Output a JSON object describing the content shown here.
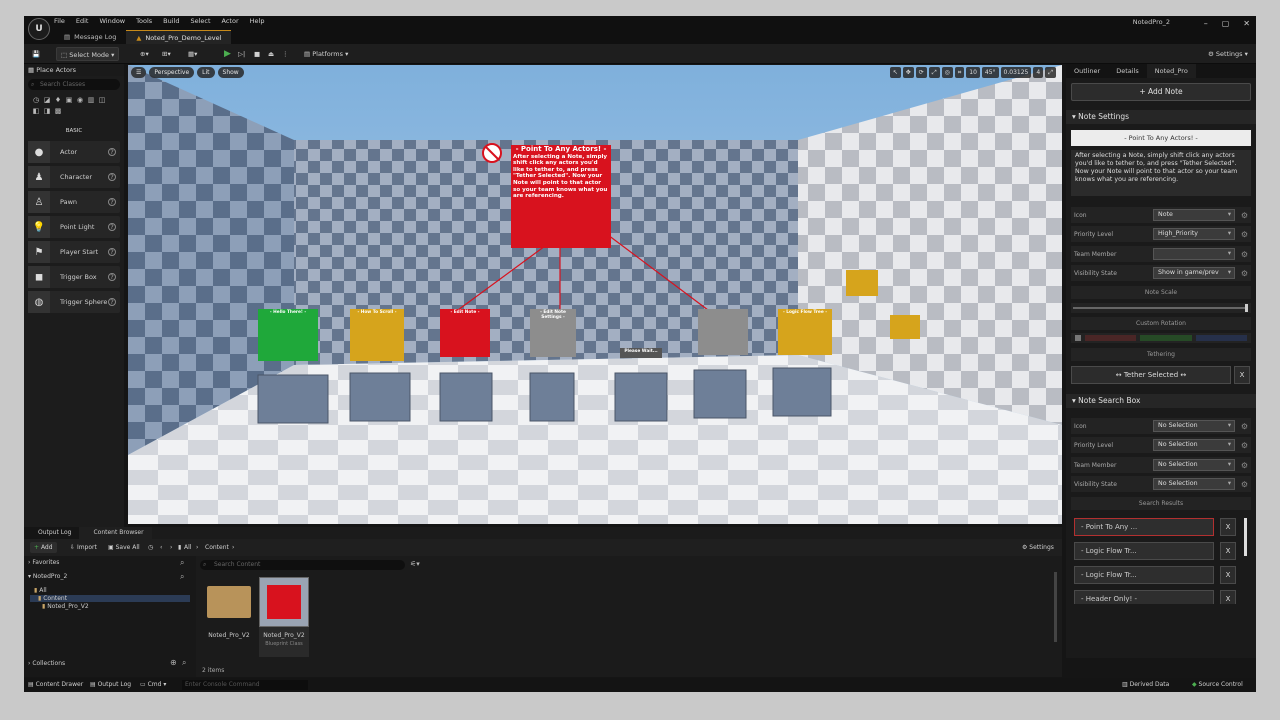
{
  "titlebar": {
    "menu": [
      "File",
      "Edit",
      "Window",
      "Tools",
      "Build",
      "Select",
      "Actor",
      "Help"
    ],
    "tabs": [
      "Message Log",
      "Noted_Pro_Demo_Level"
    ],
    "project": "NotedPro_2",
    "controls": [
      "–",
      "▢",
      "✕"
    ]
  },
  "toolbar": {
    "select_mode": "Select Mode",
    "platforms": "Platforms",
    "settings": "Settings"
  },
  "place_actors": {
    "title": "Place Actors",
    "search_placeholder": "Search Classes",
    "section": "BASIC",
    "items": [
      "Actor",
      "Character",
      "Pawn",
      "Point Light",
      "Player Start",
      "Trigger Box",
      "Trigger Sphere"
    ]
  },
  "viewport": {
    "perspective": "Perspective",
    "lit": "Lit",
    "show": "Show",
    "angle": "45°",
    "scale": "0.03125",
    "cam": "4",
    "grid": "10",
    "main_note": {
      "title": "- Point To Any Actors! -",
      "body": "After selecting a Note, simply shift click any actors you'd like to tether to, and press \"Tether Selected\". Now your Note will point to that actor so your team knows what you are referencing."
    },
    "note_hello": "- Hello There! -",
    "note_scroll": "- How To Scroll -",
    "note_edit": "- Edit Note -",
    "note_settings": "- Edit Note Settings -",
    "note_logic": "- Logic Flow Tree -",
    "note_ready": "Please Wait..."
  },
  "right_panel": {
    "tabs": [
      "Outliner",
      "Details",
      "Noted_Pro"
    ],
    "add_note": "+ Add Note",
    "note_settings_hdr": "Note Settings",
    "note_title": "- Point To Any Actors! -",
    "note_body": "After selecting a Note, simply shift click any actors you'd like to tether to, and press \"Tether Selected\". Now your Note will point to that actor so your team knows what you are referencing.",
    "settings_rows": [
      {
        "label": "Icon",
        "value": "Note"
      },
      {
        "label": "Priority Level",
        "value": "High_Priority"
      },
      {
        "label": "Team Member",
        "value": ""
      },
      {
        "label": "Visibility State",
        "value": "Show in game/prev"
      }
    ],
    "note_scale": "Note Scale",
    "custom_rotation": "Custom Rotation",
    "tethering": "Tethering",
    "tether_selected": "↔ Tether Selected ↔",
    "x": "X",
    "search_box_hdr": "Note Search Box",
    "search_rows": [
      {
        "label": "Icon",
        "value": "No Selection"
      },
      {
        "label": "Priority Level",
        "value": "No Selection"
      },
      {
        "label": "Team Member",
        "value": "No Selection"
      },
      {
        "label": "Visibility State",
        "value": "No Selection"
      }
    ],
    "search_results": "Search Results",
    "results": [
      "- Point To Any ...",
      "- Logic Flow Tr...",
      "- Logic Flow Tr...",
      "- Header Only! -"
    ]
  },
  "bottom": {
    "tabs": [
      "Output Log",
      "Content Browser"
    ],
    "add": "Add",
    "import": "Import",
    "save_all": "Save All",
    "path": [
      "All",
      "Content"
    ],
    "settings": "Settings",
    "favorites": "Favorites",
    "project": "NotedPro_2",
    "tree": [
      "All",
      "Content",
      "Noted_Pro_V2"
    ],
    "collections": "Collections",
    "search_placeholder": "Search Content",
    "assets": [
      {
        "name": "Noted_Pro_V2",
        "type": ""
      },
      {
        "name": "Noted_Pro_V2",
        "type": "Blueprint Class"
      }
    ],
    "item_count": "2 items"
  },
  "statusbar": {
    "content_drawer": "Content Drawer",
    "output_log": "Output Log",
    "cmd": "Cmd",
    "console_placeholder": "Enter Console Command",
    "derived_data": "Derived Data",
    "source_control": "Source Control"
  },
  "colors": {
    "note_red": "#d8121e",
    "note_green": "#1fa83a",
    "note_yellow": "#d6a41c",
    "note_gray": "#8d8d8d",
    "accent_orange": "#c78a1a"
  }
}
